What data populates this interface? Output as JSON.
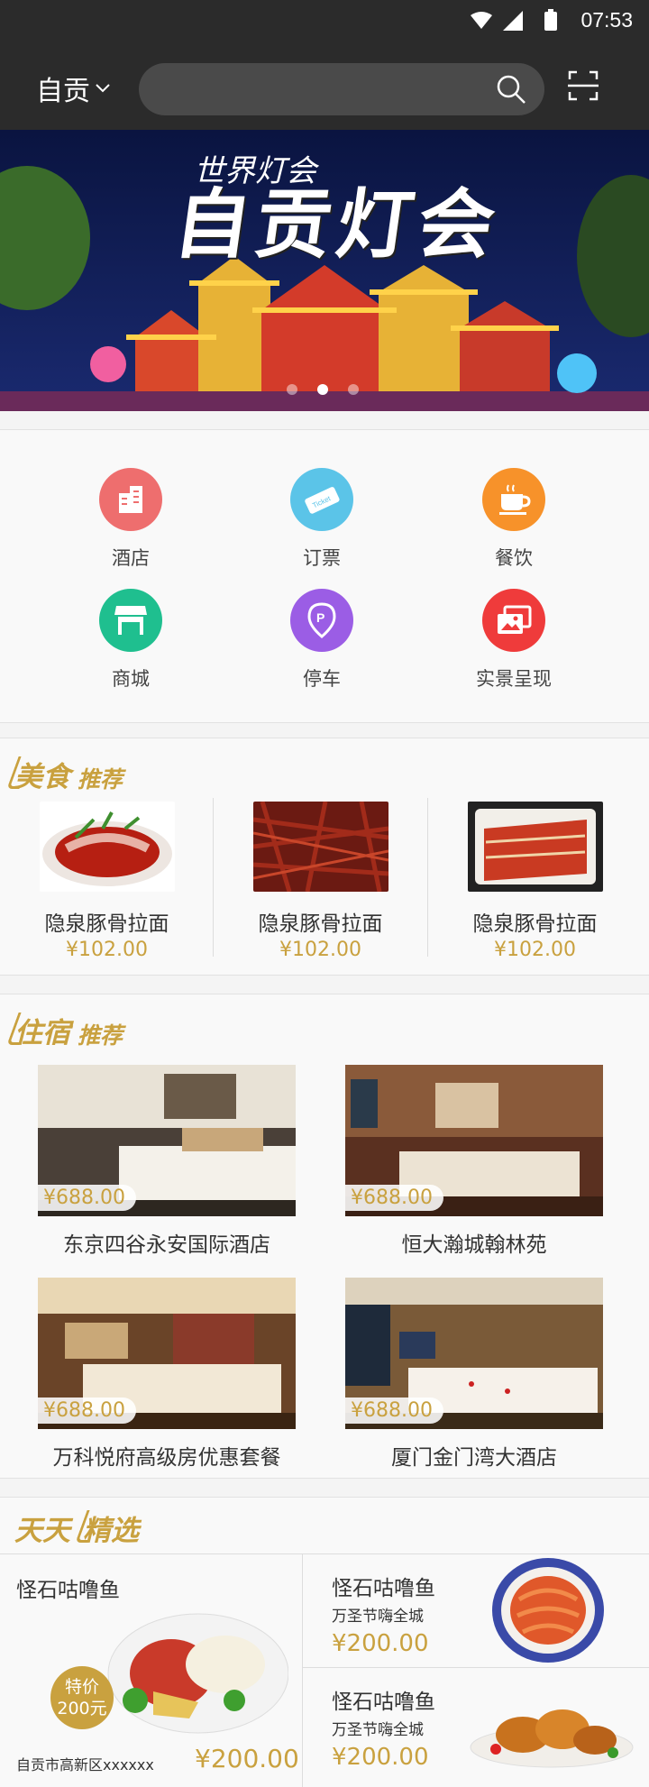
{
  "status_bar": {
    "time": "07:53"
  },
  "header": {
    "city": "自贡",
    "search_placeholder": ""
  },
  "banner": {
    "subtitle": "世界灯会",
    "title": "自贡灯会",
    "dots": 3,
    "active_dot": 2
  },
  "categories": [
    {
      "label": "酒店",
      "icon": "hotel-building-icon",
      "color": "#ee6e6e"
    },
    {
      "label": "订票",
      "icon": "ticket-icon",
      "color": "#5bc4e8"
    },
    {
      "label": "餐饮",
      "icon": "coffee-cup-icon",
      "color": "#f7922a"
    },
    {
      "label": "商城",
      "icon": "shop-icon",
      "color": "#1fbf8f"
    },
    {
      "label": "停车",
      "icon": "parking-icon",
      "color": "#9b5de5"
    },
    {
      "label": "实景呈现",
      "icon": "photo-icon",
      "color": "#ef3b3b"
    }
  ],
  "food_section": {
    "title_big": "美食",
    "title_small": "推荐",
    "items": [
      {
        "name": "隐泉豚骨拉面",
        "price": "¥102.00"
      },
      {
        "name": "隐泉豚骨拉面",
        "price": "¥102.00"
      },
      {
        "name": "隐泉豚骨拉面",
        "price": "¥102.00"
      }
    ]
  },
  "hotel_section": {
    "title_big": "住宿",
    "title_small": "推荐",
    "items": [
      {
        "name": "东京四谷永安国际酒店",
        "price": "¥688.00"
      },
      {
        "name": "恒大瀚城翰林苑",
        "price": "¥688.00"
      },
      {
        "name": "万科悦府高级房优惠套餐",
        "price": "¥688.00"
      },
      {
        "name": "厦门金门湾大酒店",
        "price": "¥688.00"
      }
    ]
  },
  "daily_section": {
    "title_big": "天天",
    "title_small": "精选",
    "main": {
      "name": "怪石咕噜鱼",
      "badge_line1": "特价",
      "badge_line2": "200元",
      "address": "自贡市高新区xxxxxx",
      "price": "¥200.00"
    },
    "side": [
      {
        "name": "怪石咕噜鱼",
        "sub": "万圣节嗨全城",
        "price": "¥200.00"
      },
      {
        "name": "怪石咕噜鱼",
        "sub": "万圣节嗨全城",
        "price": "¥200.00"
      }
    ]
  },
  "colors": {
    "accent": "#c9a13f",
    "header_bg": "#2b2b2b"
  }
}
